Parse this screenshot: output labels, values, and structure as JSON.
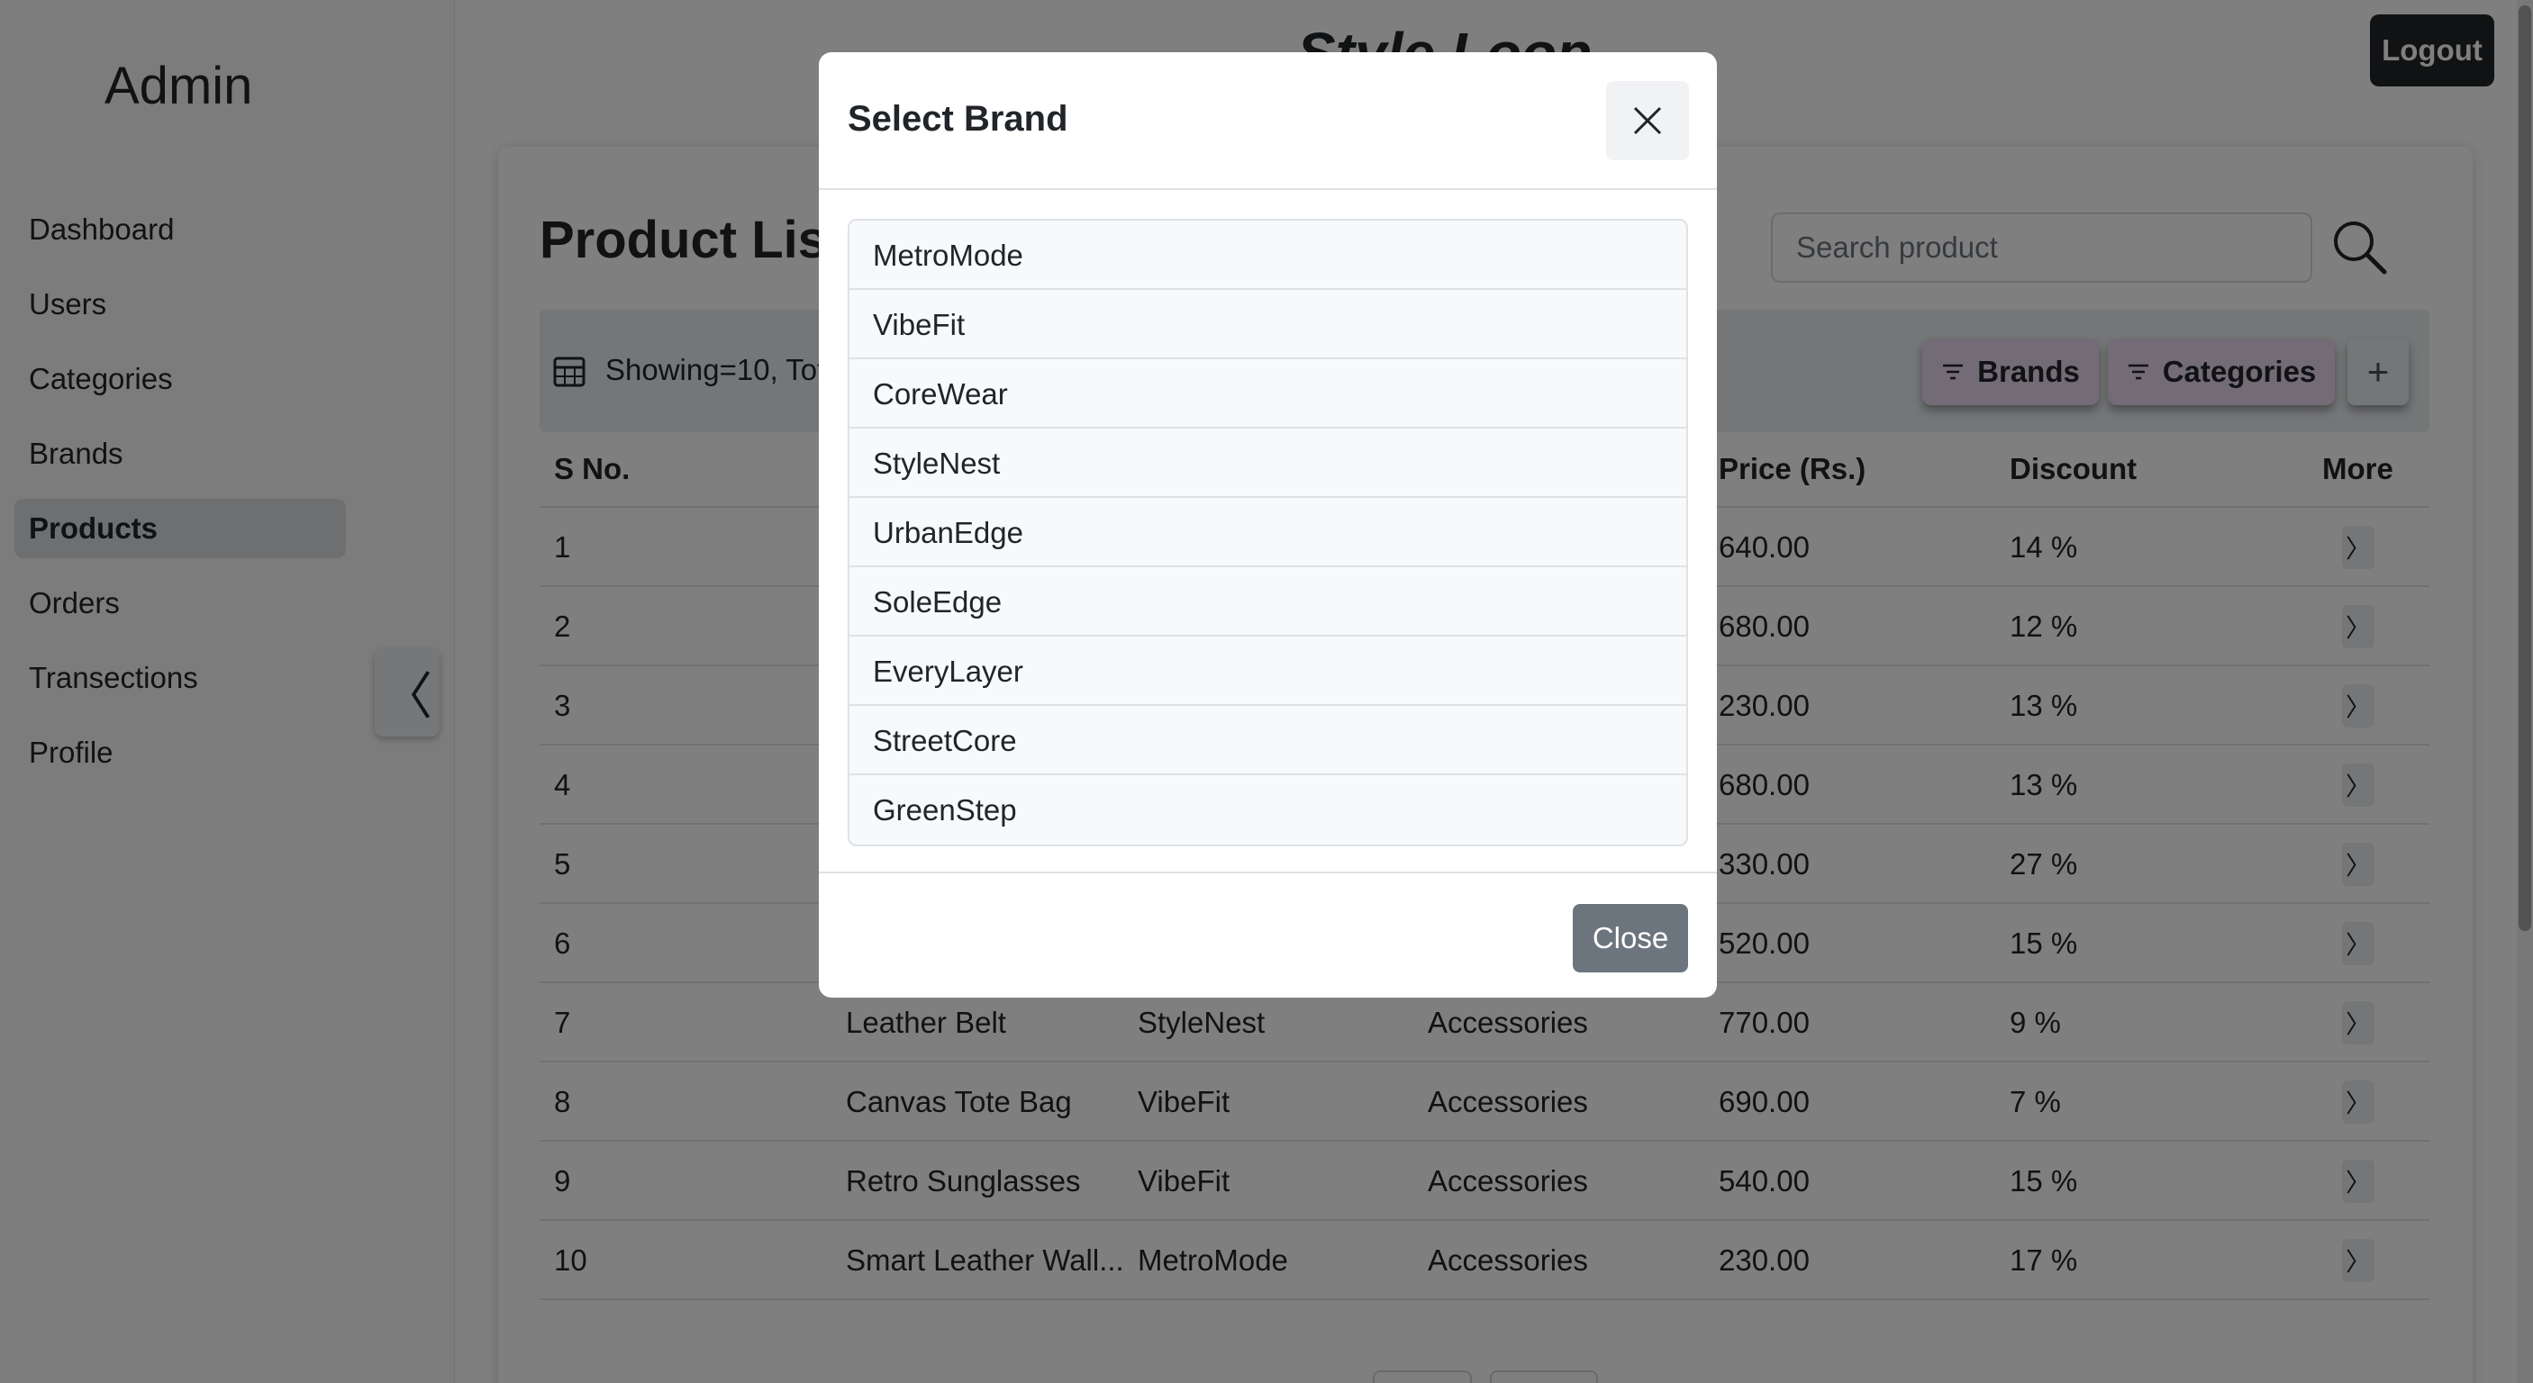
{
  "sidebar": {
    "title": "Admin",
    "items": [
      {
        "label": "Dashboard",
        "active": false
      },
      {
        "label": "Users",
        "active": false
      },
      {
        "label": "Categories",
        "active": false
      },
      {
        "label": "Brands",
        "active": false
      },
      {
        "label": "Products",
        "active": true
      },
      {
        "label": "Orders",
        "active": false
      },
      {
        "label": "Transections",
        "active": false
      },
      {
        "label": "Profile",
        "active": false
      }
    ],
    "collapse_icon": "chevron-left-icon",
    "collapse_glyph": "〈"
  },
  "header": {
    "app_title": "Style Loop",
    "logout_label": "Logout"
  },
  "main": {
    "page_title": "Product List",
    "search_placeholder": "Search product",
    "showing_text": "Showing=10, Tot",
    "brands_button": "Brands",
    "categories_button": "Categories",
    "add_button": "+",
    "columns": [
      "S No.",
      "Price (Rs.)",
      "Discount",
      "More"
    ],
    "rows": [
      {
        "sno": "1",
        "name": "",
        "brand": "",
        "category": "",
        "price": "640.00",
        "discount": "14 %"
      },
      {
        "sno": "2",
        "name": "",
        "brand": "",
        "category": "",
        "price": "680.00",
        "discount": "12 %"
      },
      {
        "sno": "3",
        "name": "",
        "brand": "",
        "category": "",
        "price": "230.00",
        "discount": "13 %"
      },
      {
        "sno": "4",
        "name": "",
        "brand": "",
        "category": "",
        "price": "680.00",
        "discount": "13 %"
      },
      {
        "sno": "5",
        "name": "",
        "brand": "",
        "category": "",
        "price": "330.00",
        "discount": "27 %"
      },
      {
        "sno": "6",
        "name": "",
        "brand": "",
        "category": "",
        "price": "520.00",
        "discount": "15 %"
      },
      {
        "sno": "7",
        "name": "Leather Belt",
        "brand": "StyleNest",
        "category": "Accessories",
        "price": "770.00",
        "discount": "9 %"
      },
      {
        "sno": "8",
        "name": "Canvas Tote Bag",
        "brand": "VibeFit",
        "category": "Accessories",
        "price": "690.00",
        "discount": "7 %"
      },
      {
        "sno": "9",
        "name": "Retro Sunglasses",
        "brand": "VibeFit",
        "category": "Accessories",
        "price": "540.00",
        "discount": "15 %"
      },
      {
        "sno": "10",
        "name": "Smart Leather Wall...",
        "brand": "MetroMode",
        "category": "Accessories",
        "price": "230.00",
        "discount": "17 %"
      }
    ],
    "more_glyph": "〉"
  },
  "modal": {
    "title": "Select Brand",
    "close_x_icon": "close-icon",
    "brands": [
      "MetroMode",
      "VibeFit",
      "CoreWear",
      "StyleNest",
      "UrbanEdge",
      "SoleEdge",
      "EveryLayer",
      "StreetCore",
      "GreenStep"
    ],
    "close_button": "Close"
  },
  "colors": {
    "dark": "#212529",
    "filter_button": "#e6d7ea",
    "secondary_button": "#6c757d",
    "backdrop": "rgba(0,0,0,0.5)"
  }
}
